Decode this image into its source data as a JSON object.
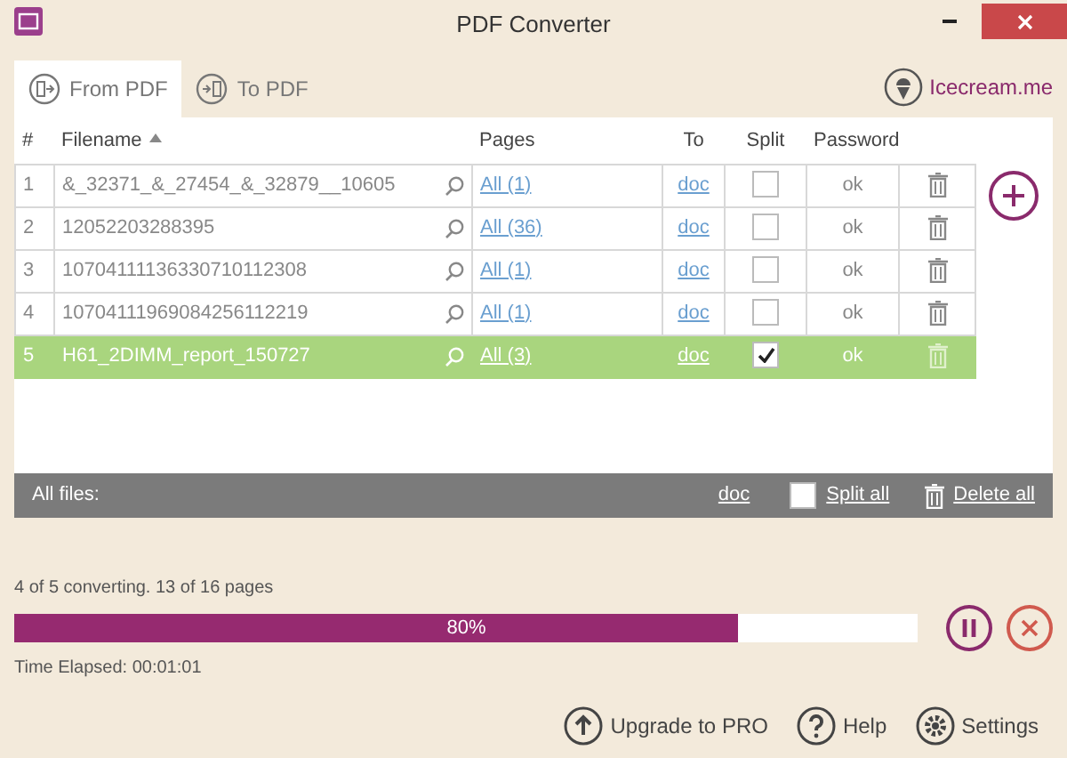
{
  "window": {
    "title": "PDF Converter"
  },
  "tabs": [
    {
      "label": "From PDF",
      "selected": true
    },
    {
      "label": "To PDF",
      "selected": false
    }
  ],
  "brand_link": "Icecream.me",
  "table": {
    "columns": [
      "#",
      "Filename",
      "Pages",
      "To",
      "Split",
      "Password"
    ],
    "rows": [
      {
        "index": "1",
        "filename": "&_32371_&_27454_&_32879__10605",
        "pages": "All (1)",
        "to": "doc",
        "split": false,
        "password": "ok",
        "selected": false
      },
      {
        "index": "2",
        "filename": "12052203288395",
        "pages": "All (36)",
        "to": "doc",
        "split": false,
        "password": "ok",
        "selected": false
      },
      {
        "index": "3",
        "filename": "10704111136330710112308",
        "pages": "All (1)",
        "to": "doc",
        "split": false,
        "password": "ok",
        "selected": false
      },
      {
        "index": "4",
        "filename": "10704111969084256112219",
        "pages": "All (1)",
        "to": "doc",
        "split": false,
        "password": "ok",
        "selected": false
      },
      {
        "index": "5",
        "filename": "H61_2DIMM_report_150727",
        "pages": "All (3)",
        "to": "doc",
        "split": true,
        "password": "ok",
        "selected": true
      }
    ]
  },
  "all_files": {
    "label": "All files:",
    "to": "doc",
    "split_all": false,
    "split_all_label": "Split all",
    "delete_all": "Delete all"
  },
  "progress": {
    "status": "4 of 5 converting. 13 of 16 pages",
    "level": 0.8,
    "reading": "80%",
    "elapsed": "Time Elapsed: 00:01:01"
  },
  "bottom_buttons": [
    {
      "kind": "upgrade",
      "label": "Upgrade to PRO"
    },
    {
      "kind": "help",
      "label": "Help"
    },
    {
      "kind": "settings",
      "label": "Settings"
    }
  ]
}
